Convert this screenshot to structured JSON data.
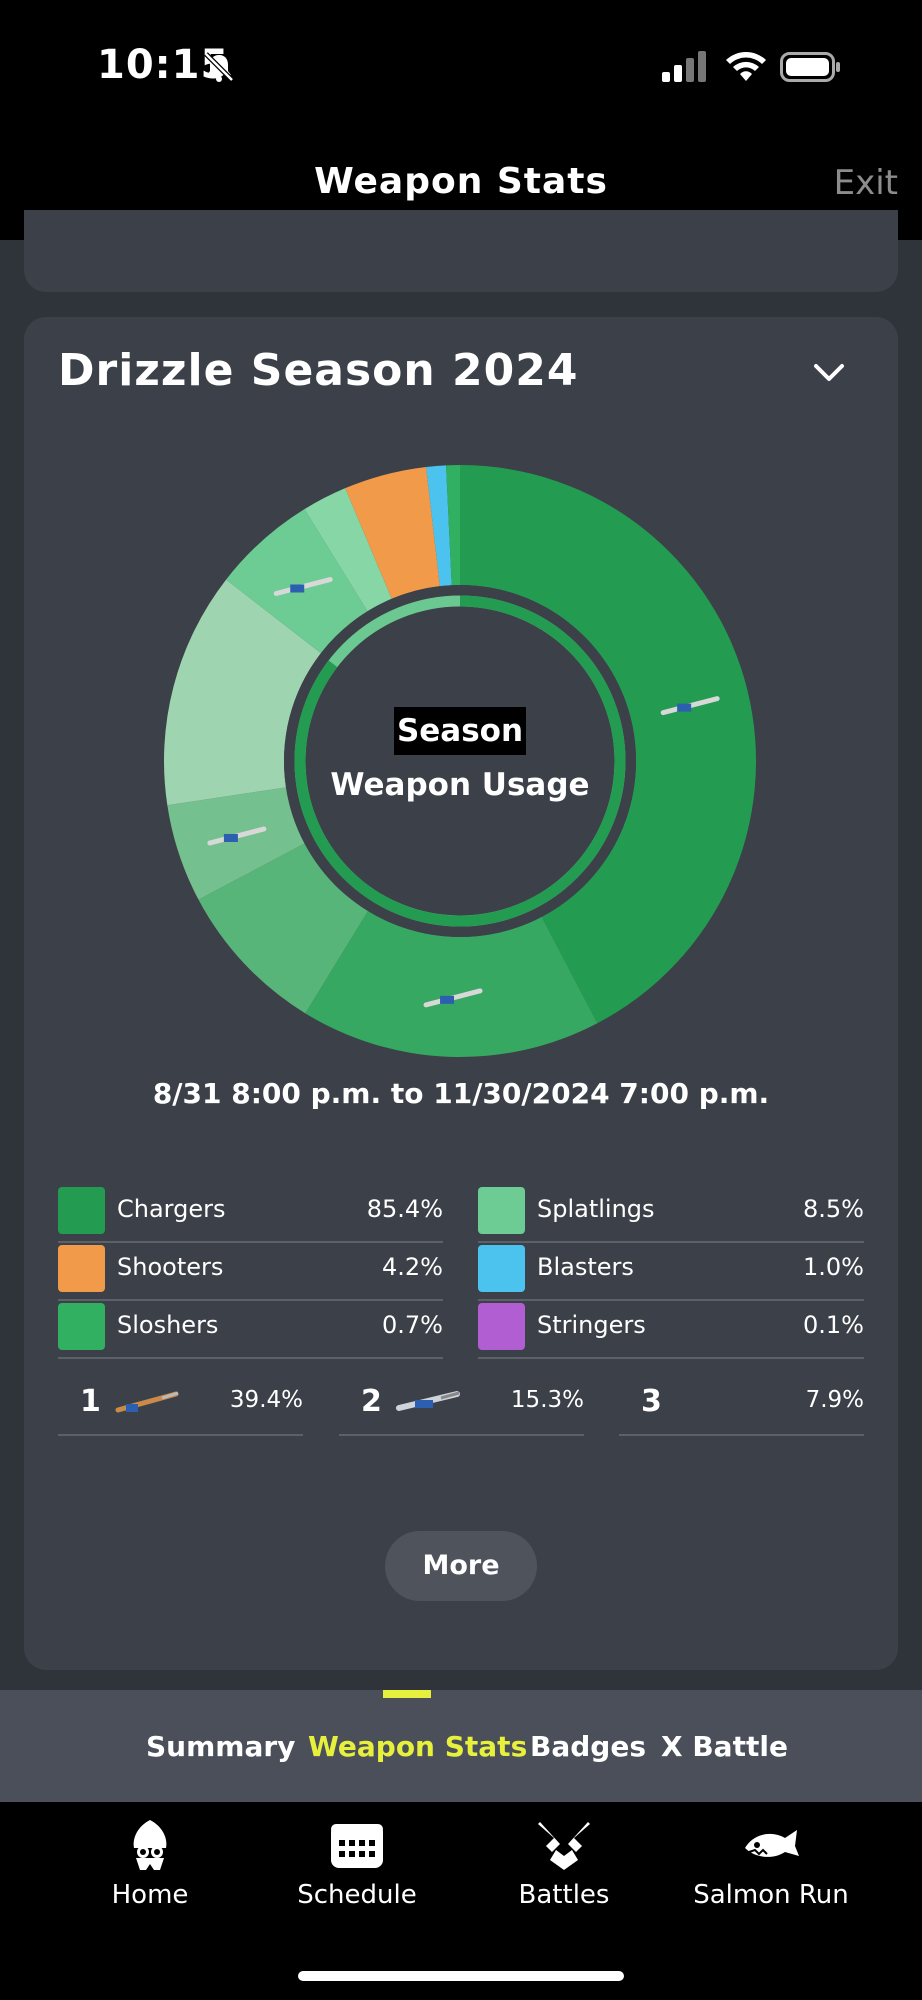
{
  "status": {
    "time": "10:15"
  },
  "header": {
    "title": "Weapon Stats",
    "exit_label": "Exit"
  },
  "card": {
    "title": "Drizzle Season 2024",
    "center_badge": "Season",
    "center_subtitle": "Weapon Usage",
    "date_range": "8/31 8:00 p.m. to 11/30/2024 7:00 p.m."
  },
  "chart_data": {
    "type": "pie",
    "style": "donut",
    "slices": [
      {
        "value": 39.4,
        "color": "#239c52"
      },
      {
        "value": 15.3,
        "color": "#36a862"
      },
      {
        "value": 7.9,
        "color": "#58b57a"
      },
      {
        "value": 5.0,
        "color": "#74c08e"
      },
      {
        "value": 12.0,
        "color": "#9fd4b0"
      },
      {
        "value": 5.3,
        "color": "#6ccc94"
      },
      {
        "value": 2.3,
        "color": "#86d6a6"
      },
      {
        "value": 4.2,
        "color": "#f19a4a"
      },
      {
        "value": 1.0,
        "color": "#4cc3ee"
      },
      {
        "value": 0.7,
        "color": "#30b060"
      }
    ],
    "inner_ring": {
      "value": 85.4,
      "color": "#239c52",
      "rest_color": "#6cc891"
    }
  },
  "legend": [
    {
      "name": "Chargers",
      "pct": "85.4%",
      "color": "#239c52",
      "icon": "charger-icon"
    },
    {
      "name": "Splatlings",
      "pct": "8.5%",
      "color": "#6ccc94",
      "icon": "splatling-icon"
    },
    {
      "name": "Shooters",
      "pct": "4.2%",
      "color": "#f19a4a",
      "icon": "shooter-icon"
    },
    {
      "name": "Blasters",
      "pct": "1.0%",
      "color": "#4cc3ee",
      "icon": "blaster-icon"
    },
    {
      "name": "Sloshers",
      "pct": "0.7%",
      "color": "#30b060",
      "icon": "slosher-icon"
    },
    {
      "name": "Stringers",
      "pct": "0.1%",
      "color": "#b15ed2",
      "icon": "stringer-icon"
    }
  ],
  "ranking": [
    {
      "rank": "1",
      "pct": "39.4%"
    },
    {
      "rank": "2",
      "pct": "15.3%"
    },
    {
      "rank": "3",
      "pct": "7.9%"
    }
  ],
  "more_label": "More",
  "tabs": [
    {
      "label": "Summary",
      "active": false
    },
    {
      "label": "Weapon Stats",
      "active": true
    },
    {
      "label": "Badges",
      "active": false
    },
    {
      "label": "X Battle",
      "active": false
    }
  ],
  "nav": [
    {
      "label": "Home",
      "icon": "squid-icon"
    },
    {
      "label": "Schedule",
      "icon": "calendar-icon"
    },
    {
      "label": "Battles",
      "icon": "battles-icon"
    },
    {
      "label": "Salmon Run",
      "icon": "salmon-icon"
    }
  ],
  "colors": {
    "accent_tab": "#e7f03c",
    "card_bg": "#3c4048"
  }
}
